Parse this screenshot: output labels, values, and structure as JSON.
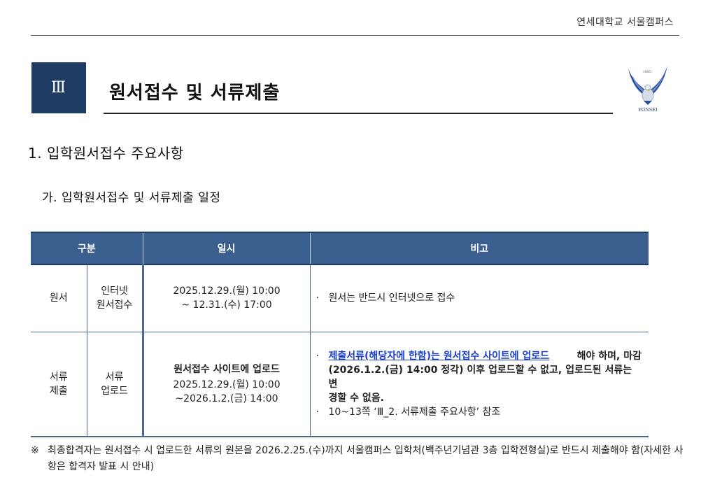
{
  "header": {
    "campus": "연세대학교 서울캠퍼스"
  },
  "section": {
    "number": "Ⅲ",
    "title": "원서접수 및 서류제출"
  },
  "logo": {
    "year": "1885",
    "name": "YONSEI"
  },
  "heading1": "1. 입학원서접수 주요사항",
  "heading2": "가. 입학원서접수 및 서류제출 일정",
  "table": {
    "headers": [
      "구분",
      "일시",
      "비고"
    ],
    "rows": [
      {
        "category": "원서",
        "subcategory": [
          "인터넷",
          "원서접수"
        ],
        "datetime": [
          "2025.12.29.(월) 10:00",
          "~ 12.31.(수) 17:00"
        ],
        "note_bullet": "·",
        "note": "원서는 반드시 인터넷으로 접수"
      },
      {
        "category": [
          "서류",
          "제출"
        ],
        "subcategory": [
          "서류",
          "업로드"
        ],
        "datetime_title": "원서접수 사이트에 업로드",
        "datetime": [
          "2025.12.29.(월) 10:00",
          "~2026.1.2.(금) 14:00"
        ],
        "note_bullet": "·",
        "note_highlight": "제출서류(해당자에 한함)는 원서접수 사이트에 업로드",
        "note_rest_1": "해야 하며, 마감",
        "note_line2": "(2026.1.2.(금) 14:00 정각) 이후 업로드할 수 없고, 업로드된 서류는 변",
        "note_line3": "경할 수 없음.",
        "note_ref": "10~13쪽 ‘Ⅲ_2. 서류제출 주요사항’ 참조"
      }
    ]
  },
  "footnote": {
    "mark": "※",
    "text": "최종합격자는 원서접수 시 업로드한 서류의 원본을 2026.2.25.(수)까지 서울캠퍼스 입학처(백주년기념관 3층 입학전형실)로 반드시 제출해야 함(자세한 사항은 합격자 발표 시 안내)"
  },
  "colors": {
    "section_box": "#1f3d63",
    "table_header": "#3a5f8f",
    "link": "#1a3fd6"
  },
  "icons": {
    "logo": "yonsei-eagle-logo"
  }
}
